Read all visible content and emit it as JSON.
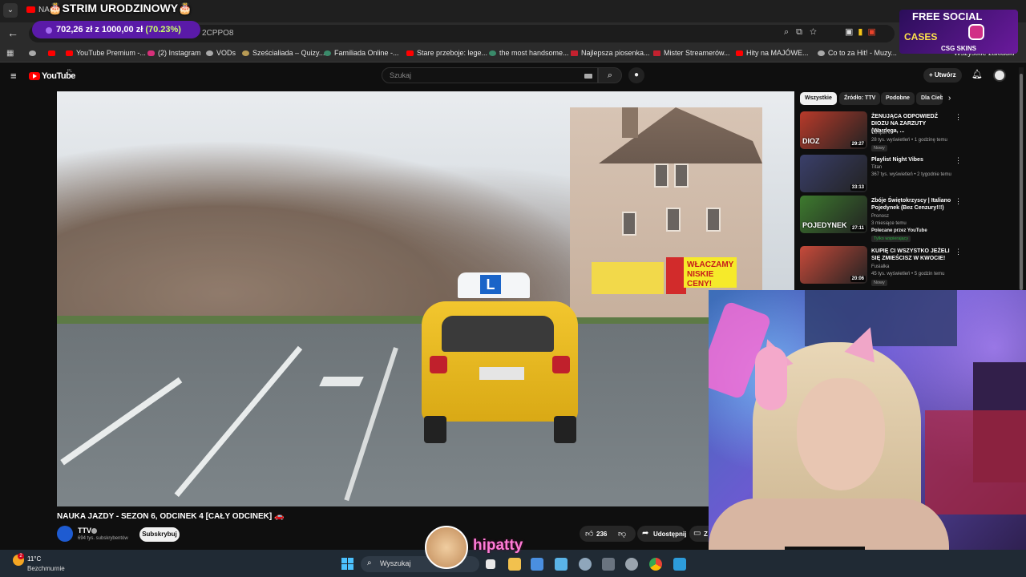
{
  "browser": {
    "tab_title": "NA",
    "url_fragment": "2CPPO8",
    "bookmarks": [
      "YouTube Premium -...",
      "(2) Instagram",
      "VODs",
      "Sześcialiada – Quizy...",
      "Familiada Online -...",
      "Stare przeboje: lege...",
      "the most handsome...",
      "Najlepsza piosenka...",
      "Mister Streamerów...",
      "Hity na MAJÓWE...",
      "Co to za Hit! - Muzy...",
      "Wszystkie zakładki"
    ]
  },
  "overlay": {
    "stream_title": "STRIM URODZINOWY",
    "donation_amount": "702,26 zł z 1000,00 zł",
    "donation_percent": "(70.23%)",
    "donation_fraction": 0.7023,
    "promo_line1": "FREE SOCIAL",
    "promo_line2": "CASES",
    "promo_sub": "CSG SKINS",
    "streamer_name": "hipatty"
  },
  "youtube": {
    "logo": "YouTube",
    "logo_region": "PL",
    "search_placeholder": "Szukaj",
    "create_label": "Utwórz",
    "video_title": "NAUKA JAZDY - SEZON 6, ODCINEK 4 [CAŁY ODCINEK] 🚗",
    "scene_text": {
      "car_sign": "L",
      "billboard": "WŁACZAMY NISKIE CENY!"
    },
    "channel": {
      "name": "TTV",
      "subscribers": "694 tys. subskrybentów",
      "subscribe_label": "Subskrybuj"
    },
    "actions": {
      "likes": "236",
      "share_label": "Udostępnij",
      "save_label": "Z"
    },
    "chips": [
      "Wszystkie",
      "Źródło: TTV",
      "Podobne",
      "Dla Ciebie"
    ],
    "recommendations": [
      {
        "title": "ŻENUJĄCA ODPOWIEDŹ DIOZU NA ZARZUTY (Wardęga, ...",
        "channel": "Gimper",
        "meta": "28 tys. wyświetleń • 1 godzinę temu",
        "badge": "Nowy",
        "duration": "29:27",
        "thumb_text": "DIOZ",
        "thumb_color": "#b83a2a"
      },
      {
        "title": "Playlist Night Vibes",
        "channel": "Titan",
        "meta": "367 tys. wyświetleń • 2 tygodnie temu",
        "badge": "",
        "duration": "33:13",
        "thumb_text": "",
        "thumb_color": "#3a3f6a"
      },
      {
        "title": "Zbóje Świętokrzyscy | Italiano Pojedynek (Bez Cenzury!!!)",
        "channel": "Pronosz",
        "meta": "3 miesiące temu",
        "badge": "Polecane przez YouTube",
        "badge2": "Tylko wspierający",
        "duration": "27:11",
        "thumb_text": "POJEDYNEK",
        "thumb_color": "#3d7a2e"
      },
      {
        "title": "KUPIĘ CI WSZYSTKO JEŻELI SIĘ ZMIEŚCISZ W KWOCIE!",
        "channel": "Fusialka",
        "meta": "45 tys. wyświetleń • 5 godzin temu",
        "badge": "Nowy",
        "duration": "20:06",
        "thumb_text": "",
        "thumb_color": "#c74a3a"
      }
    ]
  },
  "taskbar": {
    "temperature": "11°C",
    "weather": "Bezchmurnie",
    "weather_badge": "2",
    "search_placeholder": "Wyszukaj"
  },
  "colors": {
    "youtube_red": "#ff0000",
    "donation_purple": "#5a1aa8",
    "percent_green": "#c8ff6a",
    "streamer_pink": "#ff7bd6"
  }
}
